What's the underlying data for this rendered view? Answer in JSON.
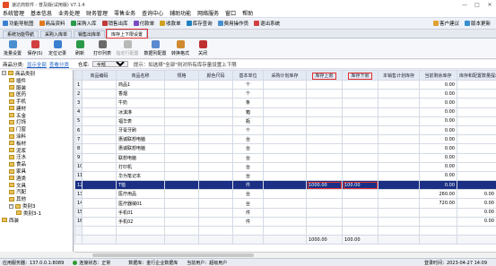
{
  "window": {
    "title": "速达商软件 - 普及版(试用版) V7.1.4",
    "buttons": [
      "—",
      "□",
      "✕"
    ]
  },
  "menu": [
    "系统管理",
    "基本信息",
    "业务处理",
    "财务管理",
    "零售业务",
    "查询中心",
    "辅助功能",
    "网络服务",
    "窗口",
    "帮助"
  ],
  "toolbar": {
    "left": [
      "功能导航图",
      "商品资料",
      "采购入库",
      "销售出库",
      "付款单",
      "收款单",
      "库存查询",
      "费用操作员",
      "退出系统"
    ],
    "right": [
      "客户建议",
      "版本更新"
    ]
  },
  "tabs": [
    "系统功能导航",
    "采购入库单",
    "销售出库单",
    "库存上下限设置"
  ],
  "active_tab": "库存上下限设置",
  "actions": [
    "批量设置",
    "保存(S)",
    "定位记录",
    "刷新",
    "打印列表",
    "指定行配置",
    "数据列配置",
    "转换格式",
    "关闭"
  ],
  "filter": {
    "label": "商品分类:",
    "link1": "显示全部",
    "link2": "查看分类",
    "warehouse_label": "仓库:",
    "warehouse_value": "全部",
    "hint": "提示：如选择\"全部\"则对所有库存量设置上下限"
  },
  "tree": [
    {
      "label": "商品类别",
      "level": 0,
      "toggle": "−"
    },
    {
      "label": "插件",
      "level": 1
    },
    {
      "label": "服装",
      "level": 1
    },
    {
      "label": "医药",
      "level": 1
    },
    {
      "label": "手机",
      "level": 1
    },
    {
      "label": "建材",
      "level": 1
    },
    {
      "label": "五金",
      "level": 1
    },
    {
      "label": "灯饰",
      "level": 1
    },
    {
      "label": "门窗",
      "level": 1
    },
    {
      "label": "涂料",
      "level": 1
    },
    {
      "label": "板材",
      "level": 1
    },
    {
      "label": "泥浆",
      "level": 1
    },
    {
      "label": "汪水",
      "level": 1
    },
    {
      "label": "食品",
      "level": 1
    },
    {
      "label": "家具",
      "level": 1
    },
    {
      "label": "酒类",
      "level": 1
    },
    {
      "label": "文具",
      "level": 1
    },
    {
      "label": "汽配",
      "level": 1
    },
    {
      "label": "其他",
      "level": 1
    },
    {
      "label": "类别3",
      "level": 1,
      "toggle": "−"
    },
    {
      "label": "类别3-1",
      "level": 2
    },
    {
      "label": "西装",
      "level": 0
    }
  ],
  "grid": {
    "columns": [
      "",
      "商品编码",
      "商品名称",
      "规格",
      "颜色尺码",
      "基本单位",
      "采购计划库存",
      "库存上限",
      "库存下限",
      "本销售计划库存",
      "当前剩余库存",
      "库存和配置数量提示"
    ],
    "highlighted": [
      "库存上限",
      "库存下限"
    ],
    "rows": [
      [
        "1",
        "",
        "商品1",
        "",
        "",
        "个",
        "",
        "",
        "",
        "",
        "0.00",
        ""
      ],
      [
        "2",
        "",
        "香烟",
        "",
        "",
        "个",
        "",
        "",
        "",
        "",
        "0.00",
        ""
      ],
      [
        "3",
        "",
        "牛奶",
        "",
        "",
        "条",
        "",
        "",
        "",
        "",
        "0.00",
        ""
      ],
      [
        "4",
        "",
        "冰淇淋",
        "",
        "",
        "箱",
        "",
        "",
        "",
        "",
        "0.00",
        ""
      ],
      [
        "5",
        "",
        "福华表",
        "",
        "",
        "瓶",
        "",
        "",
        "",
        "",
        "0.00",
        ""
      ],
      [
        "6",
        "",
        "牙膏牙刷",
        "",
        "",
        "个",
        "",
        "",
        "",
        "",
        "0.00",
        ""
      ],
      [
        "7",
        "",
        "惠诚联想电脑",
        "",
        "",
        "台",
        "",
        "",
        "",
        "",
        "0.00",
        ""
      ],
      [
        "8",
        "",
        "惠诚联想电脑",
        "",
        "",
        "台",
        "",
        "",
        "",
        "",
        "0.00",
        ""
      ],
      [
        "9",
        "",
        "联想电脑",
        "",
        "",
        "台",
        "",
        "",
        "",
        "",
        "0.00",
        ""
      ],
      [
        "10",
        "",
        "打印机",
        "",
        "",
        "台",
        "",
        "",
        "",
        "",
        "0.00",
        ""
      ],
      [
        "11",
        "",
        "华为笔记本",
        "",
        "",
        "台",
        "",
        "",
        "",
        "",
        "0.00",
        ""
      ],
      [
        "12",
        "",
        "T恤",
        "",
        "",
        "件",
        "",
        "1000.00",
        "100.00",
        "",
        "0.00",
        ""
      ],
      [
        "13",
        "",
        "医疗用品",
        "",
        "",
        "台",
        "",
        "",
        "",
        "",
        "260.00",
        "0.00"
      ],
      [
        "14",
        "",
        "医疗器械01",
        "",
        "",
        "台",
        "",
        "",
        "",
        "",
        "720.00",
        "0.00"
      ],
      [
        "15",
        "",
        "手机01",
        "",
        "",
        "件",
        "",
        "",
        "",
        "",
        "",
        "0.00"
      ],
      [
        "16",
        "",
        "手机02",
        "",
        "",
        "件",
        "",
        "",
        "",
        "",
        "",
        "0.00"
      ]
    ],
    "selected_row": 11,
    "totals": [
      "",
      "",
      "",
      "",
      "",
      "",
      "",
      "1000.00",
      "100.00",
      "",
      "",
      ""
    ]
  },
  "status": {
    "server": "应用服务器：137.0.0.1:8089",
    "conn": "连接状态：正常",
    "db": "数据库：金行企业数据库",
    "user": "当前用户：超级用户",
    "time": "登录时间：2023-04-27 14:09"
  },
  "colors": {
    "accent": "#e03030",
    "selected": "#1b2f84",
    "link": "#1a5fc0"
  }
}
